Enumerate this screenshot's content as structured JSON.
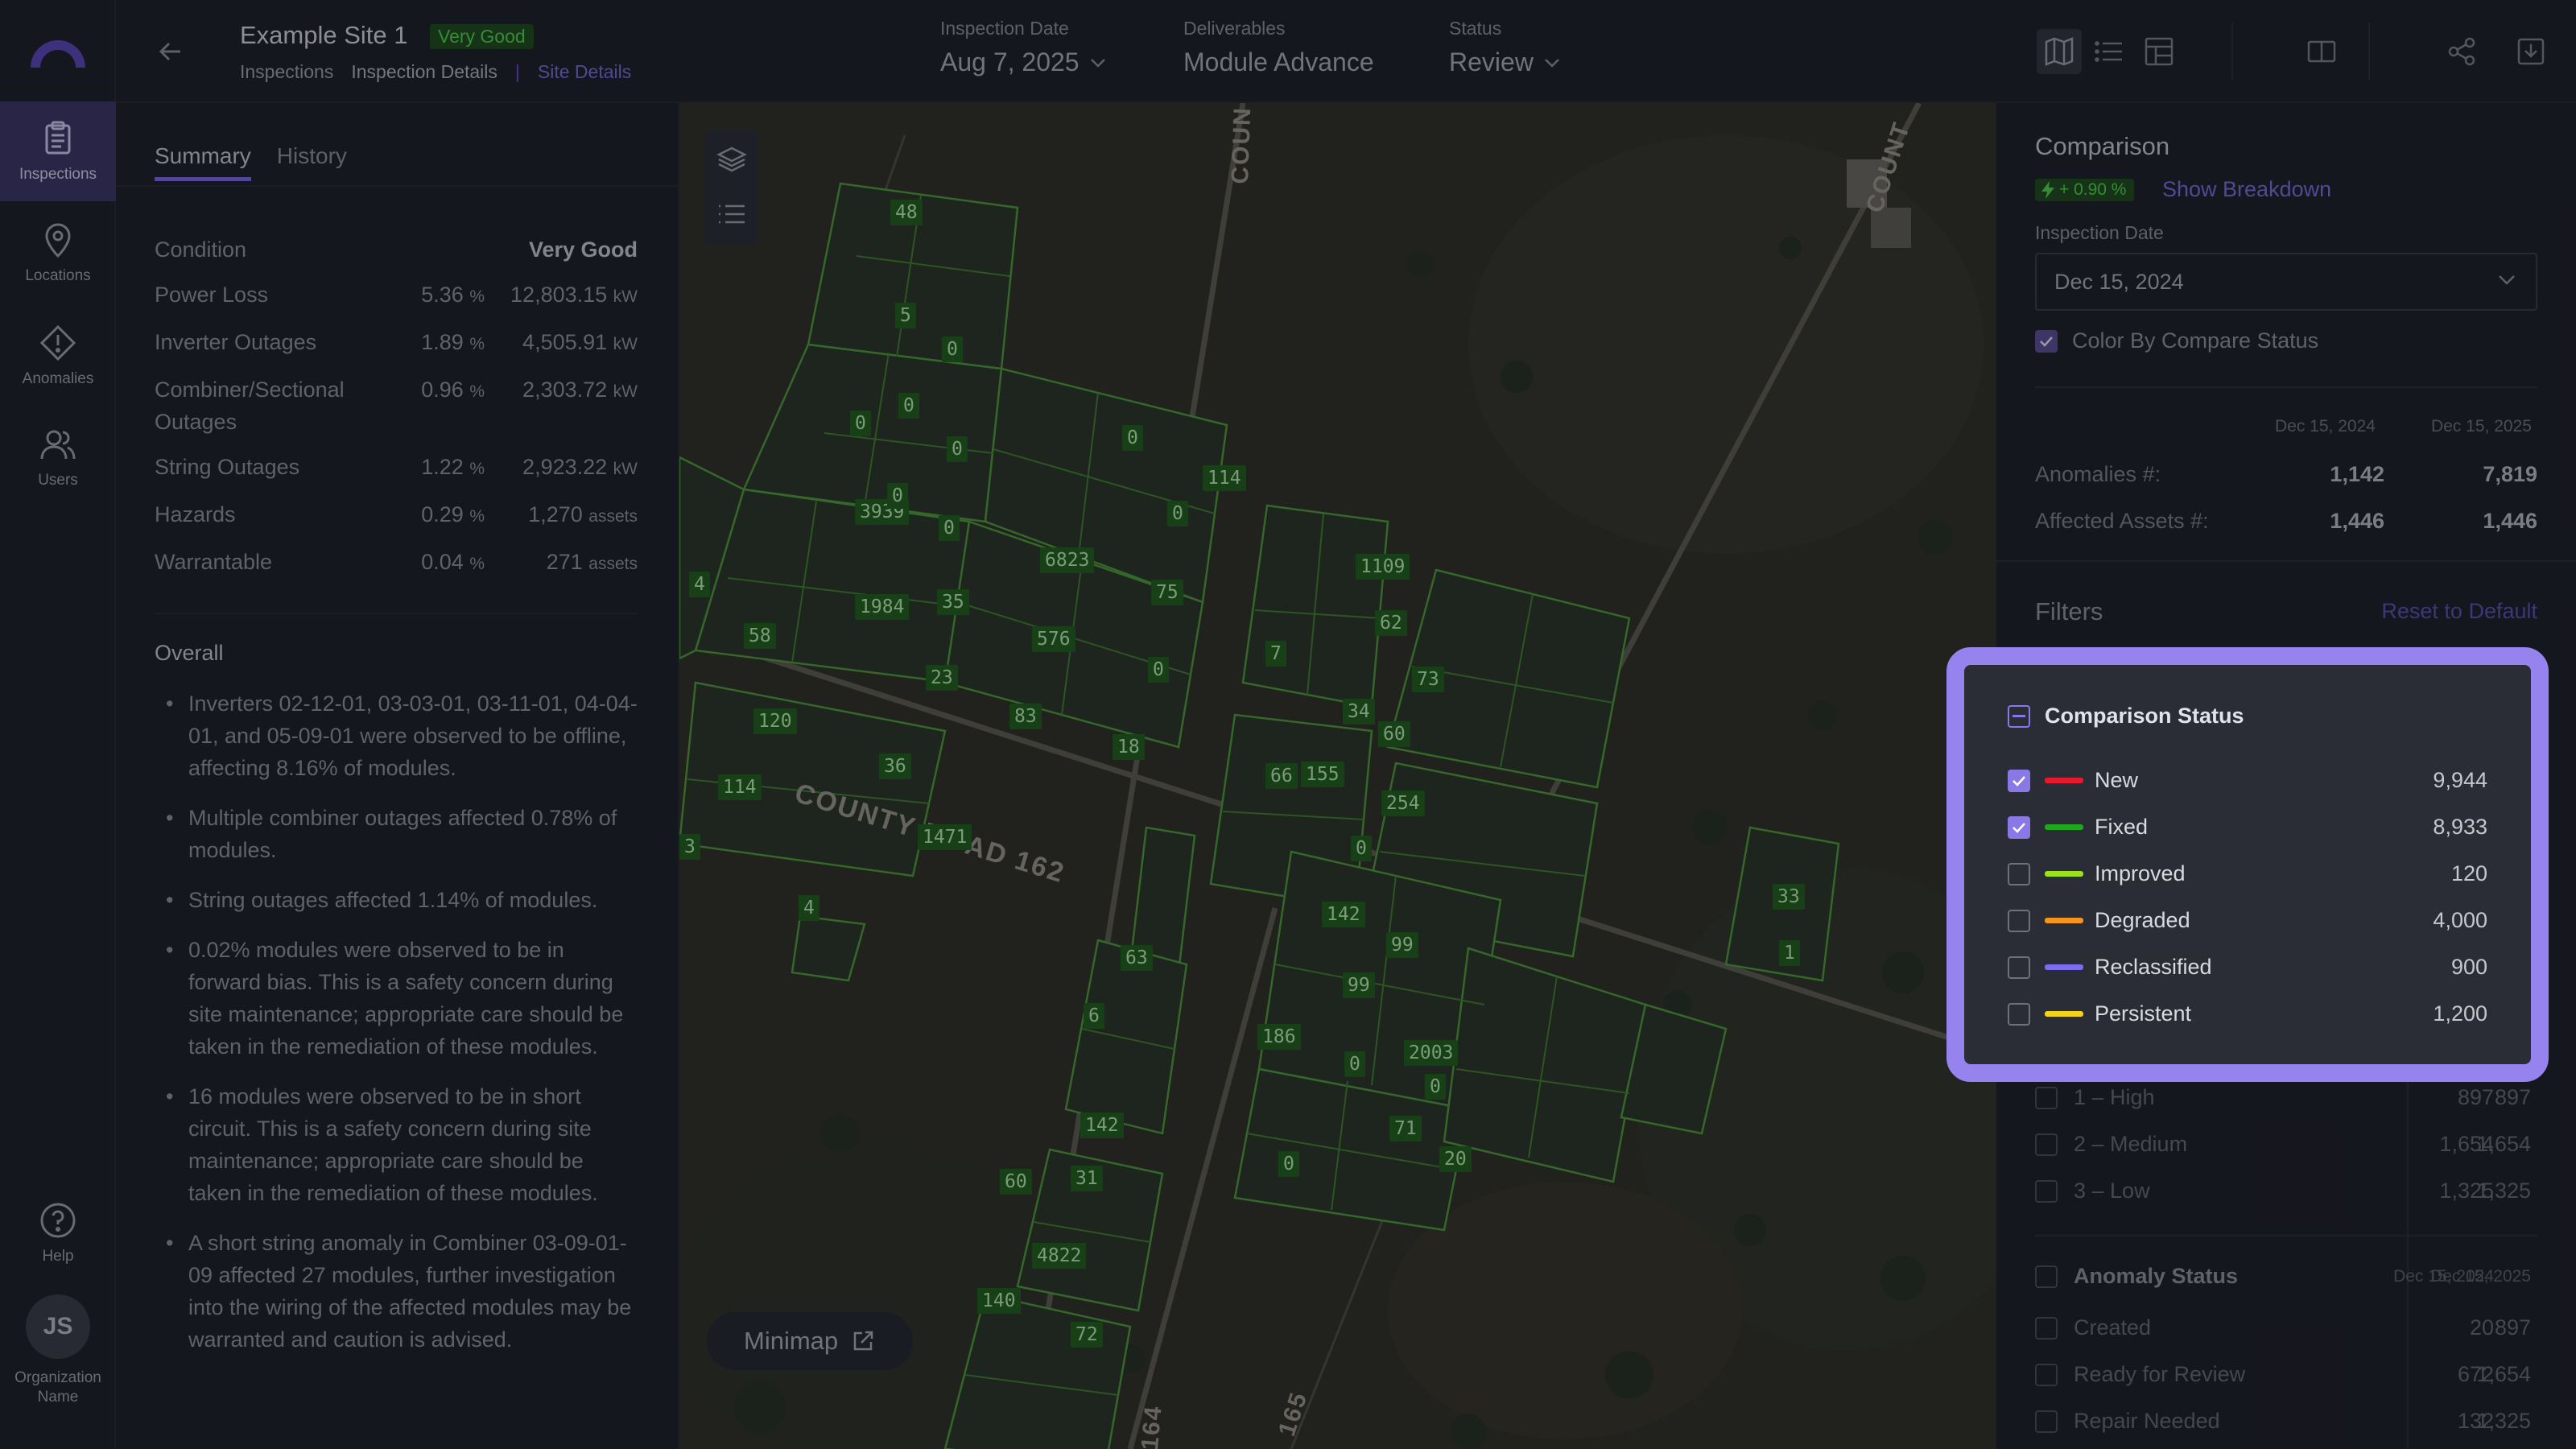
{
  "rail": {
    "items": [
      {
        "label": "Inspections",
        "icon": "clipboard-icon",
        "active": true
      },
      {
        "label": "Locations",
        "icon": "map-pin-icon",
        "active": false
      },
      {
        "label": "Anomalies",
        "icon": "warning-diamond-icon",
        "active": false
      },
      {
        "label": "Users",
        "icon": "users-icon",
        "active": false
      }
    ],
    "help": "Help",
    "avatar_initials": "JS",
    "org_line1": "Organization",
    "org_line2": "Name"
  },
  "header": {
    "site_title": "Example Site 1",
    "site_badge": "Very Good",
    "breadcrumb": [
      "Inspections",
      "Inspection Details",
      "Site Details"
    ],
    "inspection_date_label": "Inspection Date",
    "inspection_date_value": "Aug 7, 2025",
    "deliverables_label": "Deliverables",
    "deliverables_value": "Module Advance",
    "status_label": "Status",
    "status_value": "Review"
  },
  "left_panel": {
    "tabs": [
      "Summary",
      "History"
    ],
    "condition_label": "Condition",
    "condition_value": "Very Good",
    "metrics": [
      {
        "name": "Power Loss",
        "pct": "5.36",
        "amount": "12,803.15",
        "unit": "kW"
      },
      {
        "name": "Inverter Outages",
        "pct": "1.89",
        "amount": "4,505.91",
        "unit": "kW"
      },
      {
        "name": "Combiner/Sectional Outages",
        "pct": "0.96",
        "amount": "2,303.72",
        "unit": "kW"
      },
      {
        "name": "String Outages",
        "pct": "1.22",
        "amount": "2,923.22",
        "unit": "kW"
      },
      {
        "name": "Hazards",
        "pct": "0.29",
        "amount": "1,270",
        "unit": "assets"
      },
      {
        "name": "Warrantable",
        "pct": "0.04",
        "amount": "271",
        "unit": "assets"
      }
    ],
    "pct_sign": "%",
    "overall_title": "Overall",
    "overall_bullets": [
      "Inverters 02-12-01, 03-03-01, 03-11-01, 04-04-01, and 05-09-01 were observed to be offline, affecting 8.16% of modules.",
      "Multiple combiner outages affected 0.78% of modules.",
      "String outages affected 1.14% of modules.",
      "0.02% modules were observed to be in forward bias. This is a safety concern during site maintenance; appropriate care should be taken in the remediation of these modules.",
      "16 modules were observed to be in short circuit. This is a safety concern during site maintenance; appropriate care should be taken in the remediation of these modules.",
      "A short string anomaly in Combiner 03-09-01-09 affected 27 modules, further investigation into the wiring of the affected modules may be warranted and caution is advised."
    ]
  },
  "map": {
    "minimap_label": "Minimap",
    "roads": [
      "COUNTY ROAD 162",
      "COUN",
      "COUNT",
      "164",
      "165"
    ],
    "block_labels": [
      "48",
      "5",
      "0",
      "0",
      "0",
      "0",
      "0",
      "114",
      "0",
      "3939",
      "0",
      "0",
      "6823",
      "75",
      "1984",
      "35",
      "4",
      "58",
      "576",
      "0",
      "23",
      "83",
      "120",
      "36",
      "18",
      "114",
      "1471",
      "3",
      "4",
      "1109",
      "7",
      "66",
      "62",
      "73",
      "34",
      "60",
      "155",
      "254",
      "0",
      "33",
      "1",
      "142",
      "99",
      "63",
      "99",
      "6",
      "186",
      "0",
      "2003",
      "0",
      "142",
      "71",
      "0",
      "20",
      "60",
      "31",
      "4822",
      "140",
      "72"
    ]
  },
  "right_panel": {
    "title": "Comparison",
    "delta": "+ 0.90 %",
    "show_breakdown": "Show Breakdown",
    "inspection_date_label": "Inspection Date",
    "inspection_date_value": "Dec 15, 2024",
    "color_by_label": "Color By Compare Status",
    "col_a": "Dec 15, 2024",
    "col_b": "Dec 15, 2025",
    "anomalies_label": "Anomalies #:",
    "anomalies_a": "1,142",
    "anomalies_b": "7,819",
    "assets_label": "Affected Assets #:",
    "assets_a": "1,446",
    "assets_b": "1,446",
    "filters_title": "Filters",
    "reset": "Reset to Default",
    "severity": [
      {
        "label": "1 – High",
        "a": "897",
        "b": "897"
      },
      {
        "label": "2 – Medium",
        "a": "1,654",
        "b": "1,654"
      },
      {
        "label": "3 – Low",
        "a": "1,325",
        "b": "1,325"
      }
    ],
    "anomaly_status_title": "Anomaly Status",
    "anomaly_status_col_a": "Dec 15, 2024",
    "anomaly_status_col_b": "Dec 15, 2025",
    "anomaly_status": [
      {
        "label": "Created",
        "a": "20",
        "b": "897"
      },
      {
        "label": "Ready for Review",
        "a": "672",
        "b": "1,654"
      },
      {
        "label": "Repair Needed",
        "a": "132",
        "b": "1,325"
      }
    ]
  },
  "comparison_popup": {
    "title": "Comparison Status",
    "rows": [
      {
        "label": "New",
        "value": "9,944",
        "checked": true,
        "color": "#e8192c"
      },
      {
        "label": "Fixed",
        "value": "8,933",
        "checked": true,
        "color": "#1fa81c"
      },
      {
        "label": "Improved",
        "value": "120",
        "checked": false,
        "color": "#9be21c"
      },
      {
        "label": "Degraded",
        "value": "4,000",
        "checked": false,
        "color": "#f7941d"
      },
      {
        "label": "Reclassified",
        "value": "900",
        "checked": false,
        "color": "#7b6cf0"
      },
      {
        "label": "Persistent",
        "value": "1,200",
        "checked": false,
        "color": "#f2d31b"
      }
    ]
  },
  "colors": {
    "accent": "#8a78e6",
    "highlight_ring": "#9683ee",
    "badge_green": "#4cd44a"
  }
}
